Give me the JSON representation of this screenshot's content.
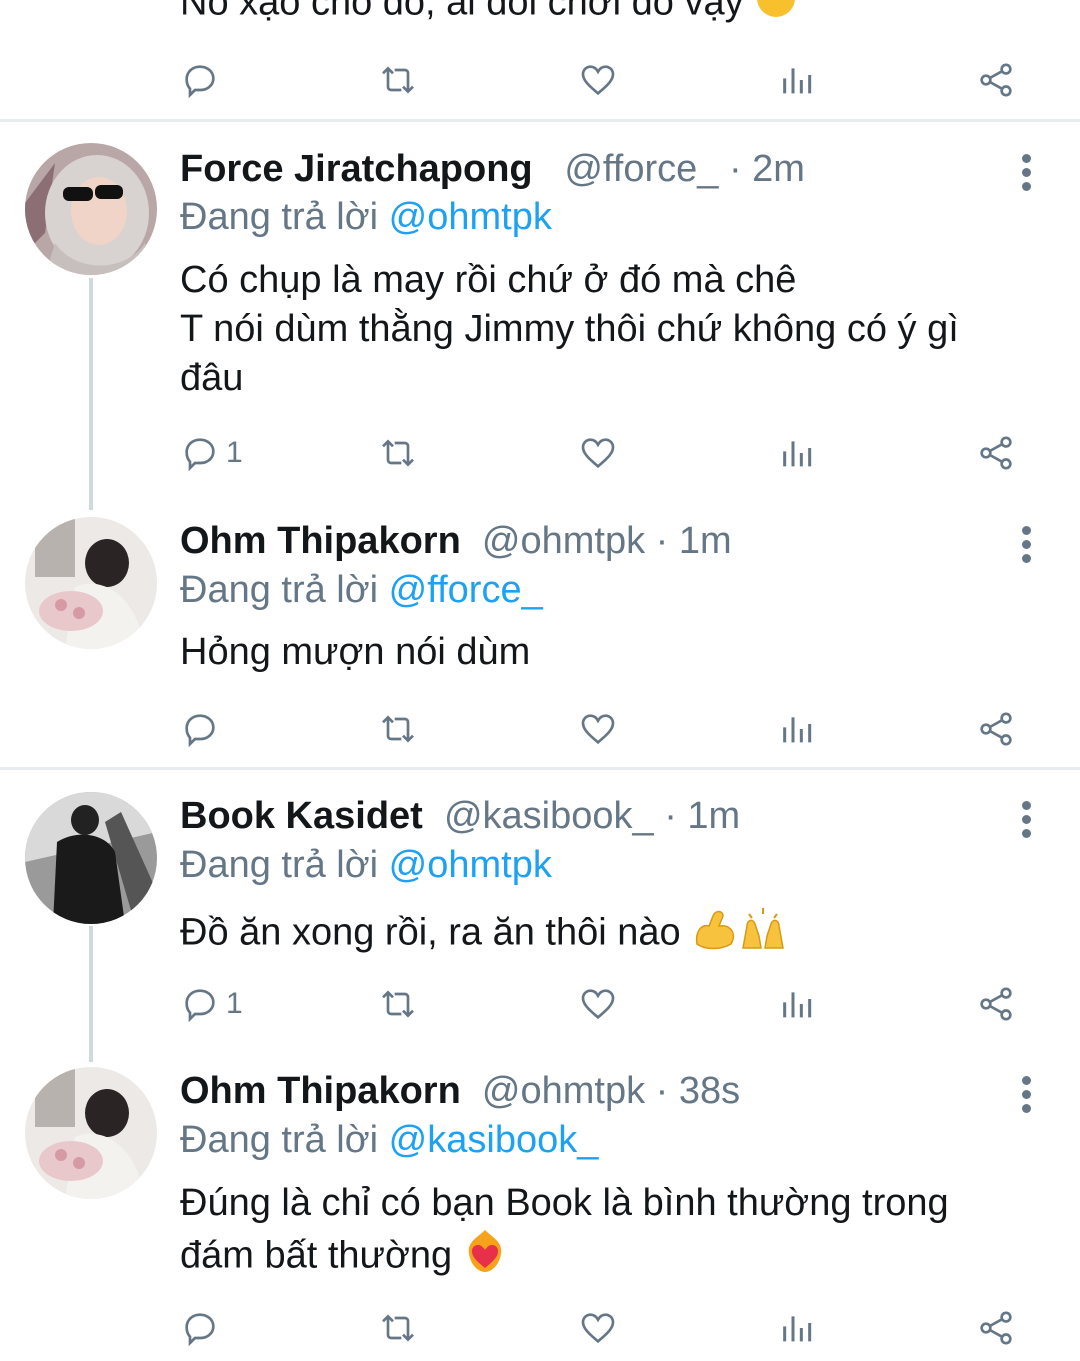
{
  "top_partial": {
    "text": "Nó xạo chó đó, ai đòi chơi dỗ vậy"
  },
  "tweets": [
    {
      "name": "Force Jiratchapong",
      "handle": "@fforce_",
      "time": "2m",
      "reply_prefix": "Đang trả lời",
      "reply_to": "@ohmtpk",
      "lines": [
        "Có chụp là may rồi chứ ở đó mà chê",
        "T nói dùm thằng Jimmy thôi chứ không có ý gì",
        "đâu"
      ],
      "reply_count": "1"
    },
    {
      "name": "Ohm Thipakorn",
      "handle": "@ohmtpk",
      "time": "1m",
      "reply_prefix": "Đang trả lời",
      "reply_to": "@fforce_",
      "lines": [
        "Hỏng mượn nói dùm"
      ],
      "reply_count": ""
    },
    {
      "name": "Book Kasidet",
      "handle": "@kasibook_",
      "time": "1m",
      "reply_prefix": "Đang trả lời",
      "reply_to": "@ohmtpk",
      "lines": [
        "Đồ ăn xong rồi, ra ăn thôi nào"
      ],
      "reply_count": "1"
    },
    {
      "name": "Ohm Thipakorn",
      "handle": "@ohmtpk",
      "time": "38s",
      "reply_prefix": "Đang trả lời",
      "reply_to": "@kasibook_",
      "lines": [
        "Đúng là chỉ có bạn Book là bình thường trong",
        "đám bất thường"
      ],
      "reply_count": ""
    }
  ],
  "icons": [
    "reply-icon",
    "retweet-icon",
    "like-icon",
    "analytics-icon",
    "share-icon",
    "more-options-icon"
  ],
  "colors": {
    "accent": "#1da1f2",
    "secondary_text": "#657786",
    "divider": "#e6ecf0"
  }
}
